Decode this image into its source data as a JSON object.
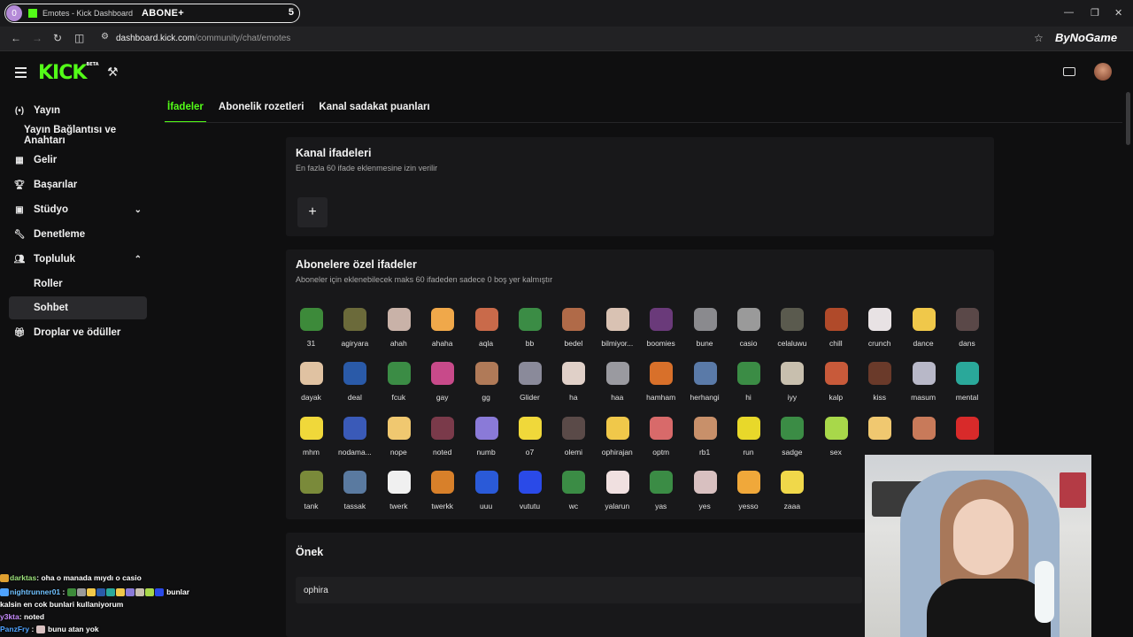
{
  "browser": {
    "tab_badge": "0",
    "tab_title": "Emotes - Kick Dashboard",
    "tab_overlay": "ABONE+",
    "tab_count": "5",
    "url_host": "dashboard.kick.com",
    "url_path": "/community/chat/emotes",
    "extension_label": "ByNoGame"
  },
  "header": {
    "logo": "KICK",
    "logo_badge": "BETA"
  },
  "sidebar": {
    "items": [
      {
        "label": "Yayın",
        "icon": "broadcast-icon"
      },
      {
        "label": "Yayın Bağlantısı ve Anahtarı",
        "icon": ""
      },
      {
        "label": "Gelir",
        "icon": "revenue-icon"
      },
      {
        "label": "Başarılar",
        "icon": "trophy-icon"
      },
      {
        "label": "Stüdyo",
        "icon": "studio-icon"
      },
      {
        "label": "Denetleme",
        "icon": "wrench-icon"
      },
      {
        "label": "Topluluk",
        "icon": "community-icon"
      },
      {
        "label": "Roller",
        "icon": ""
      },
      {
        "label": "Sohbet",
        "icon": ""
      },
      {
        "label": "Droplar ve ödüller",
        "icon": "gift-icon"
      }
    ]
  },
  "tabs": [
    {
      "label": "İfadeler",
      "active": true
    },
    {
      "label": "Abonelik rozetleri",
      "active": false
    },
    {
      "label": "Kanal sadakat puanları",
      "active": false
    }
  ],
  "channel_emotes": {
    "title": "Kanal ifadeleri",
    "subtitle": "En fazla 60 ifade eklenmesine izin verilir",
    "add_label": "+"
  },
  "sub_emotes": {
    "title": "Abonelere özel ifadeler",
    "subtitle": "Aboneler için eklenebilecek maks 60 ifadeden sadece 0 boş yer kalmıştır",
    "emotes": [
      {
        "name": "31",
        "color": "#3d8a3a"
      },
      {
        "name": "agiryara",
        "color": "#6b6a3a"
      },
      {
        "name": "ahah",
        "color": "#c9b2a8"
      },
      {
        "name": "ahaha",
        "color": "#f0a84a"
      },
      {
        "name": "aqla",
        "color": "#c96a4a"
      },
      {
        "name": "bb",
        "color": "#3b8c45"
      },
      {
        "name": "bedel",
        "color": "#b06a48"
      },
      {
        "name": "bilmiyor...",
        "color": "#d9c2b3"
      },
      {
        "name": "boomies",
        "color": "#6a3a7a"
      },
      {
        "name": "bune",
        "color": "#8a8a8e"
      },
      {
        "name": "casio",
        "color": "#9a9a9a"
      },
      {
        "name": "celaluwu",
        "color": "#5a5a4e"
      },
      {
        "name": "chill",
        "color": "#b04a2a"
      },
      {
        "name": "crunch",
        "color": "#e8e2e4"
      },
      {
        "name": "dance",
        "color": "#f0c84a"
      },
      {
        "name": "dans",
        "color": "#5a4848"
      },
      {
        "name": "dayak",
        "color": "#e0c2a2"
      },
      {
        "name": "deal",
        "color": "#2a5aa8"
      },
      {
        "name": "fcuk",
        "color": "#3b8c45"
      },
      {
        "name": "gay",
        "color": "#c84a8a"
      },
      {
        "name": "gg",
        "color": "#b07a58"
      },
      {
        "name": "Glider",
        "color": "#8a8a9a"
      },
      {
        "name": "ha",
        "color": "#e0d0c8"
      },
      {
        "name": "haa",
        "color": "#9a9aa0"
      },
      {
        "name": "hamham",
        "color": "#d8702a"
      },
      {
        "name": "herhangi",
        "color": "#5a7aa8"
      },
      {
        "name": "hi",
        "color": "#3b8c45"
      },
      {
        "name": "iyy",
        "color": "#c8bfae"
      },
      {
        "name": "kalp",
        "color": "#c85a3a"
      },
      {
        "name": "kiss",
        "color": "#6a3a2a"
      },
      {
        "name": "masum",
        "color": "#b8b8c8"
      },
      {
        "name": "mental",
        "color": "#2aa89a"
      },
      {
        "name": "mhm",
        "color": "#f0d83a"
      },
      {
        "name": "nodama...",
        "color": "#3a5ab8"
      },
      {
        "name": "nope",
        "color": "#f0c870"
      },
      {
        "name": "noted",
        "color": "#7a3a4a"
      },
      {
        "name": "numb",
        "color": "#8a7ad8"
      },
      {
        "name": "o7",
        "color": "#f0d83a"
      },
      {
        "name": "olemi",
        "color": "#5a4a48"
      },
      {
        "name": "ophirajan",
        "color": "#f0c84a"
      },
      {
        "name": "optm",
        "color": "#d86a6a"
      },
      {
        "name": "rb1",
        "color": "#c8906a"
      },
      {
        "name": "run",
        "color": "#e8d82a"
      },
      {
        "name": "sadge",
        "color": "#3b8c45"
      },
      {
        "name": "sex",
        "color": "#a8d84a"
      },
      {
        "name": "",
        "color": "#f0c870"
      },
      {
        "name": "",
        "color": "#c87a5a"
      },
      {
        "name": "",
        "color": "#d82a2a"
      },
      {
        "name": "tank",
        "color": "#7a8a3a"
      },
      {
        "name": "tassak",
        "color": "#5a7aa0"
      },
      {
        "name": "twerk",
        "color": "#f0f0f0"
      },
      {
        "name": "twerkk",
        "color": "#d8802a"
      },
      {
        "name": "uuu",
        "color": "#2a5ad8"
      },
      {
        "name": "vututu",
        "color": "#2a4ae8"
      },
      {
        "name": "wc",
        "color": "#3b8c45"
      },
      {
        "name": "yalarun",
        "color": "#f0e0e0"
      },
      {
        "name": "yas",
        "color": "#3b8c45"
      },
      {
        "name": "yes",
        "color": "#d8c0c0"
      },
      {
        "name": "yesso",
        "color": "#f0a83a"
      },
      {
        "name": "zaaa",
        "color": "#f0d84a"
      }
    ]
  },
  "prefix": {
    "title": "Önek",
    "value": "ophira"
  },
  "chat": [
    {
      "user": "darktas",
      "text": ": oha o manada mıydı o casio"
    },
    {
      "user": "nightrunner01",
      "text": "bunlar"
    },
    {
      "user": "",
      "text": "kalsin en cok bunlari kullaniyorum"
    },
    {
      "user": "y3kta",
      "text": ": noted"
    },
    {
      "user": "PanzFry",
      "text": "bunu atan yok"
    }
  ]
}
